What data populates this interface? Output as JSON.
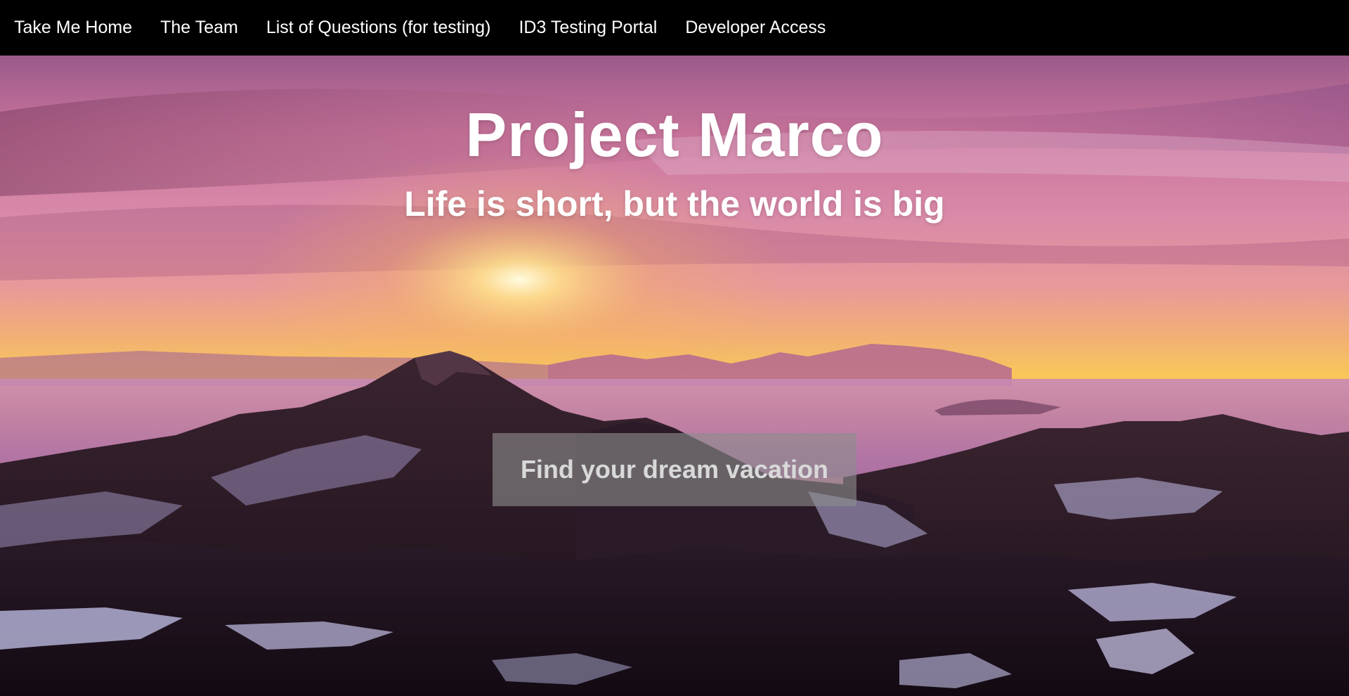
{
  "nav": {
    "items": [
      {
        "label": "Take Me Home"
      },
      {
        "label": "The Team"
      },
      {
        "label": "List of Questions (for testing)"
      },
      {
        "label": "ID3 Testing Portal"
      },
      {
        "label": "Developer Access"
      }
    ]
  },
  "hero": {
    "title": "Project Marco",
    "subtitle": "Life is short, but the world is big",
    "cta_label": "Find your dream vacation",
    "background": "sunset-over-snowy-mountains-image"
  },
  "colors": {
    "nav_background": "#000000",
    "nav_text": "#ffffff",
    "hero_text": "#ffffff",
    "cta_background": "#8c8c8c",
    "cta_text": "#d9d9d9"
  }
}
